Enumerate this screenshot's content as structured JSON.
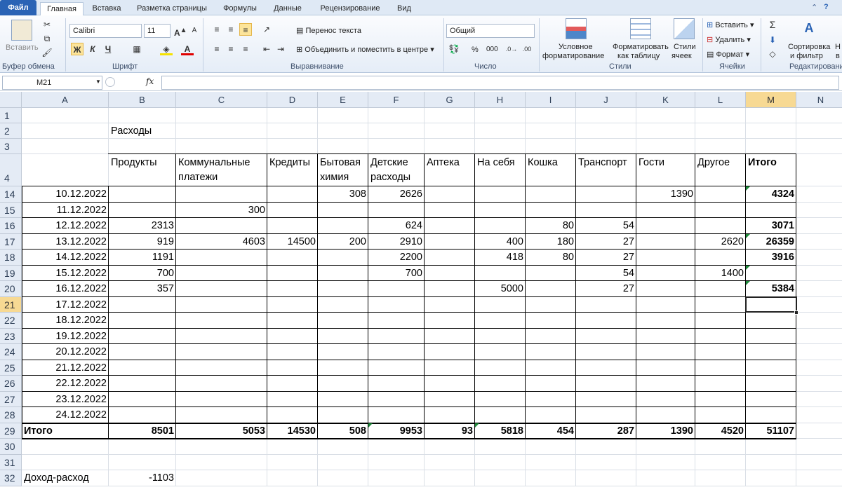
{
  "ribbon_tabs": {
    "file": "Файл",
    "home": "Главная",
    "insert": "Вставка",
    "layout": "Разметка страницы",
    "formulas": "Формулы",
    "data": "Данные",
    "review": "Рецензирование",
    "view": "Вид"
  },
  "ribbon": {
    "clipboard": {
      "paste": "Вставить",
      "label": "Буфер обмена"
    },
    "font": {
      "name": "Calibri",
      "size": "11",
      "bold": "Ж",
      "italic": "К",
      "underline": "Ч",
      "label": "Шрифт"
    },
    "alignment": {
      "wrap": "Перенос текста",
      "merge": "Объединить и поместить в центре",
      "label": "Выравнивание"
    },
    "number": {
      "format": "Общий",
      "percent": "%",
      "thousands": "000",
      "label": "Число"
    },
    "styles": {
      "cond1": "Условное",
      "cond2": "форматирование",
      "fmt1": "Форматировать",
      "fmt2": "как таблицу",
      "cell1": "Стили",
      "cell2": "ячеек",
      "label": "Стили"
    },
    "cells": {
      "insert": "Вставить",
      "delete": "Удалить",
      "format": "Формат",
      "label": "Ячейки"
    },
    "editing": {
      "sort1": "Сортировка",
      "sort2": "и фильтр",
      "find1": "Н",
      "find2": "в",
      "label": "Редактирование"
    }
  },
  "formula_bar": {
    "name_box": "M21",
    "fx": "fx",
    "value": ""
  },
  "columns": [
    "A",
    "B",
    "C",
    "D",
    "E",
    "F",
    "G",
    "H",
    "I",
    "J",
    "K",
    "L",
    "M",
    "N"
  ],
  "selected_column": "M",
  "selected_row": "21",
  "row_numbers": [
    "1",
    "2",
    "3",
    "4",
    "14",
    "15",
    "16",
    "17",
    "18",
    "19",
    "20",
    "21",
    "22",
    "23",
    "24",
    "25",
    "26",
    "27",
    "28",
    "29",
    "30",
    "31",
    "32"
  ],
  "sheet": {
    "title": "Расходы",
    "headers": [
      [
        "Продукты"
      ],
      [
        "Коммунальные",
        "платежи"
      ],
      [
        "Кредиты"
      ],
      [
        "Бытовая",
        "химия"
      ],
      [
        "Детские",
        "расходы"
      ],
      [
        "Аптека"
      ],
      [
        "На себя"
      ],
      [
        "Кошка"
      ],
      [
        "Транспорт"
      ],
      [
        "Гости"
      ],
      [
        "Другое"
      ],
      [
        "Итого"
      ]
    ],
    "rows": [
      {
        "date": "10.12.2022",
        "v": [
          "",
          "",
          "",
          "308",
          "2626",
          "",
          "",
          "",
          "",
          "1390",
          "",
          "4324"
        ]
      },
      {
        "date": "11.12.2022",
        "v": [
          "",
          "300",
          "",
          "",
          "",
          "",
          "",
          "",
          "",
          "",
          "",
          ""
        ]
      },
      {
        "date": "12.12.2022",
        "v": [
          "2313",
          "",
          "",
          "",
          "624",
          "",
          "",
          "80",
          "54",
          "",
          "",
          "3071"
        ]
      },
      {
        "date": "13.12.2022",
        "v": [
          "919",
          "4603",
          "14500",
          "200",
          "2910",
          "",
          "400",
          "180",
          "27",
          "",
          "2620",
          "26359"
        ]
      },
      {
        "date": "14.12.2022",
        "v": [
          "1191",
          "",
          "",
          "",
          "2200",
          "",
          "418",
          "80",
          "27",
          "",
          "",
          "3916"
        ]
      },
      {
        "date": "15.12.2022",
        "v": [
          "700",
          "",
          "",
          "",
          "700",
          "",
          "",
          "",
          "54",
          "",
          "1400",
          ""
        ]
      },
      {
        "date": "16.12.2022",
        "v": [
          "357",
          "",
          "",
          "",
          "",
          "",
          "5000",
          "",
          "27",
          "",
          "",
          "5384"
        ]
      },
      {
        "date": "17.12.2022",
        "v": [
          "",
          "",
          "",
          "",
          "",
          "",
          "",
          "",
          "",
          "",
          "",
          ""
        ]
      },
      {
        "date": "18.12.2022",
        "v": [
          "",
          "",
          "",
          "",
          "",
          "",
          "",
          "",
          "",
          "",
          "",
          ""
        ]
      },
      {
        "date": "19.12.2022",
        "v": [
          "",
          "",
          "",
          "",
          "",
          "",
          "",
          "",
          "",
          "",
          "",
          ""
        ]
      },
      {
        "date": "20.12.2022",
        "v": [
          "",
          "",
          "",
          "",
          "",
          "",
          "",
          "",
          "",
          "",
          "",
          ""
        ]
      },
      {
        "date": "21.12.2022",
        "v": [
          "",
          "",
          "",
          "",
          "",
          "",
          "",
          "",
          "",
          "",
          "",
          ""
        ]
      },
      {
        "date": "22.12.2022",
        "v": [
          "",
          "",
          "",
          "",
          "",
          "",
          "",
          "",
          "",
          "",
          "",
          ""
        ]
      },
      {
        "date": "23.12.2022",
        "v": [
          "",
          "",
          "",
          "",
          "",
          "",
          "",
          "",
          "",
          "",
          "",
          ""
        ]
      },
      {
        "date": "24.12.2022",
        "v": [
          "",
          "",
          "",
          "",
          "",
          "",
          "",
          "",
          "",
          "",
          "",
          ""
        ]
      }
    ],
    "total_label": "Итого",
    "totals": [
      "8501",
      "5053",
      "14530",
      "508",
      "9953",
      "93",
      "5818",
      "454",
      "287",
      "1390",
      "4520",
      "51107"
    ],
    "balance_label": "Доход-расход",
    "balance_value": "-1103"
  }
}
